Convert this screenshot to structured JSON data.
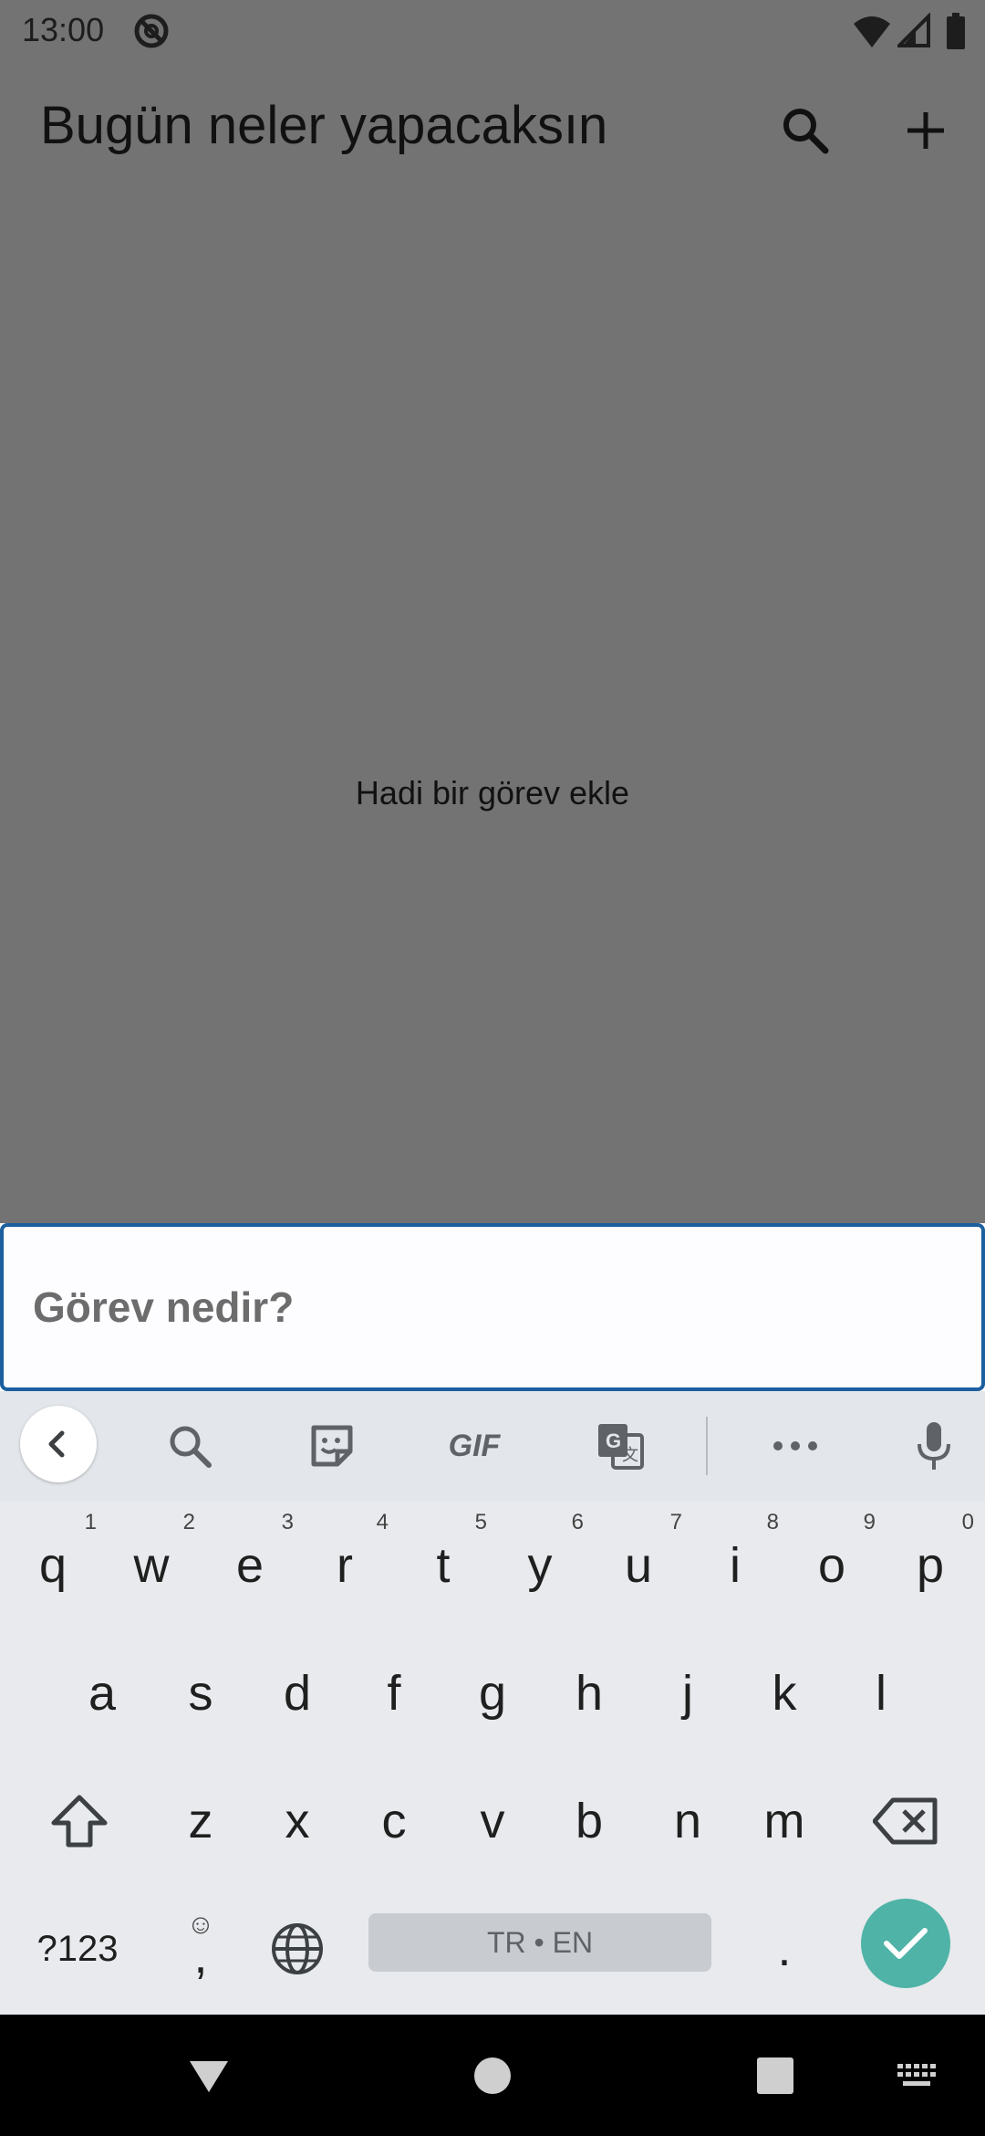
{
  "status_bar": {
    "time": "13:00"
  },
  "app_bar": {
    "title": "Bugün neler yapacaksın"
  },
  "empty_state": {
    "text": "Hadi bir görev ekle"
  },
  "task_input": {
    "placeholder": "Görev nedir?",
    "value": ""
  },
  "keyboard": {
    "toolbar": {
      "gif_label": "GIF"
    },
    "row1": [
      {
        "key": "q",
        "hint": "1"
      },
      {
        "key": "w",
        "hint": "2"
      },
      {
        "key": "e",
        "hint": "3"
      },
      {
        "key": "r",
        "hint": "4"
      },
      {
        "key": "t",
        "hint": "5"
      },
      {
        "key": "y",
        "hint": "6"
      },
      {
        "key": "u",
        "hint": "7"
      },
      {
        "key": "i",
        "hint": "8"
      },
      {
        "key": "o",
        "hint": "9"
      },
      {
        "key": "p",
        "hint": "0"
      }
    ],
    "row2": [
      "a",
      "s",
      "d",
      "f",
      "g",
      "h",
      "j",
      "k",
      "l"
    ],
    "row3": [
      "z",
      "x",
      "c",
      "v",
      "b",
      "n",
      "m"
    ],
    "symbols_label": "?123",
    "comma_label": ",",
    "space_label": "TR • EN",
    "period_label": "."
  },
  "colors": {
    "accent": "#4fb3a7",
    "input_border": "#1b5f9e",
    "scrim": "#737373"
  }
}
